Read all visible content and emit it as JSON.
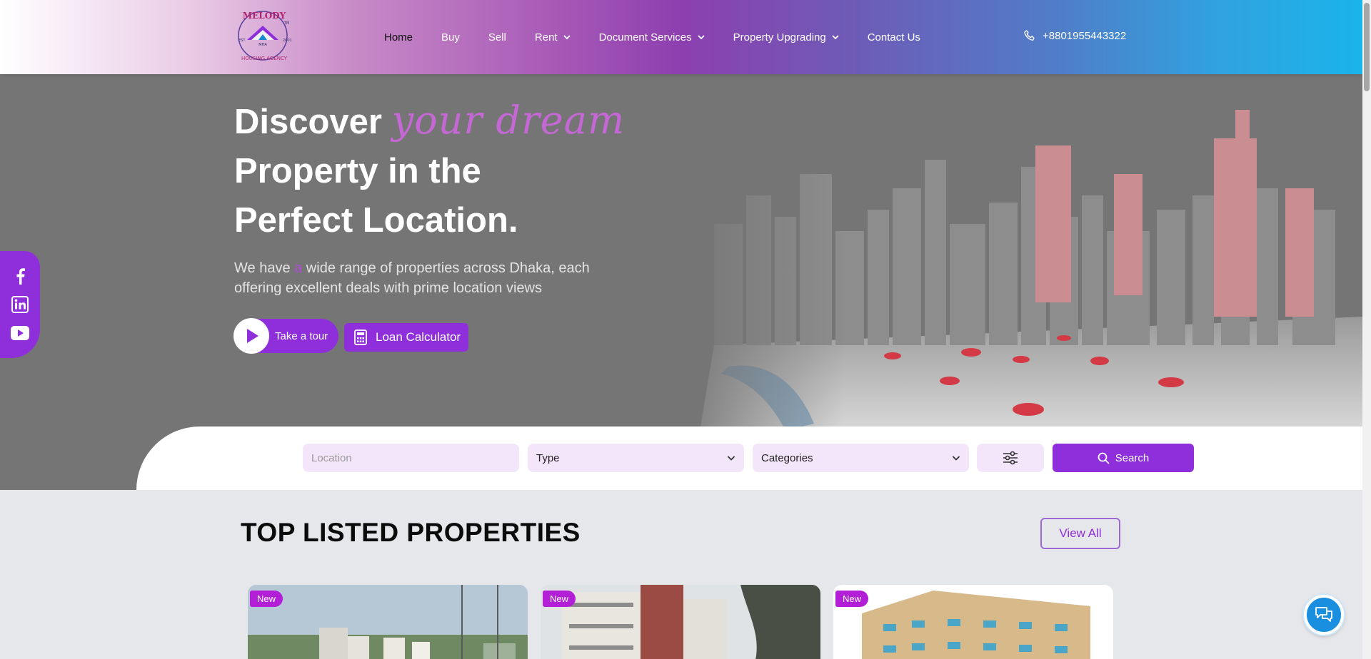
{
  "brand": {
    "logo_text_top": "MELODY",
    "logo_text_bottom": "HOUSING AGENCY",
    "logo_mark": "MHA",
    "logo_est": "EST.",
    "logo_year": "2001",
    "logo_tm": "TM"
  },
  "nav": {
    "items": [
      {
        "label": "Home",
        "dropdown": false
      },
      {
        "label": "Buy",
        "dropdown": false
      },
      {
        "label": "Sell",
        "dropdown": false
      },
      {
        "label": "Rent",
        "dropdown": true
      },
      {
        "label": "Document Services",
        "dropdown": true
      },
      {
        "label": "Property Upgrading",
        "dropdown": true
      },
      {
        "label": "Contact Us",
        "dropdown": false
      }
    ],
    "phone": "+8801955443322"
  },
  "hero": {
    "title_word1": "Discover",
    "title_script": "your dream",
    "title_line2": "Property in the",
    "title_line3": "Perfect Location.",
    "sub_part1": "We have ",
    "sub_accent": "a",
    "sub_part2": " wide range of properties across Dhaka, each offering excellent deals with prime location views",
    "tour_label": "Take a tour",
    "loan_label": "Loan Calculator"
  },
  "social": {
    "icons": [
      "facebook-icon",
      "linkedin-icon",
      "youtube-icon"
    ]
  },
  "search": {
    "location_placeholder": "Location",
    "type_label": "Type",
    "categories_label": "Categories",
    "search_label": "Search"
  },
  "section": {
    "title": "TOP LISTED PROPERTIES",
    "view_all": "View All"
  },
  "cards": [
    {
      "badge": "New"
    },
    {
      "badge": "New"
    },
    {
      "badge": "New"
    }
  ],
  "colors": {
    "accent": "#8f2fdc",
    "badge": "#b21fd6",
    "script": "#c568d6",
    "chat": "#1a8fe0"
  }
}
